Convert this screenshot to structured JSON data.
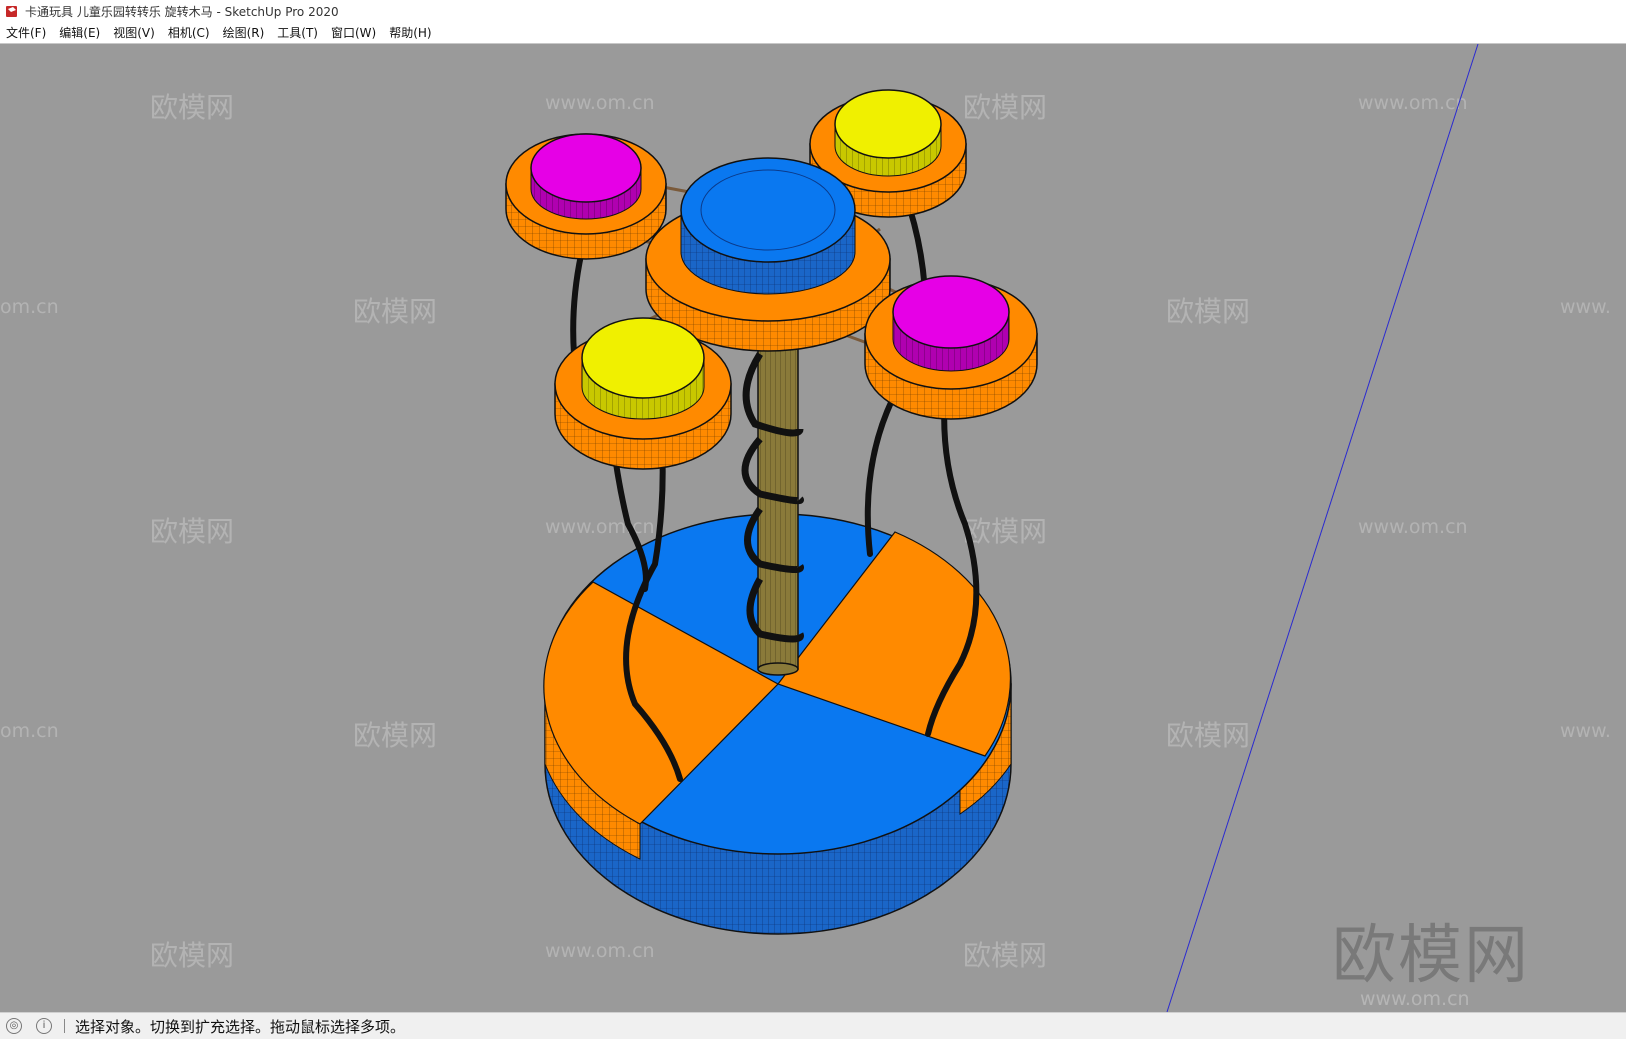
{
  "window": {
    "title": "卡通玩具 儿童乐园转转乐 旋转木马 - SketchUp Pro 2020"
  },
  "menubar": {
    "items": [
      {
        "label": "文件(F)"
      },
      {
        "label": "编辑(E)"
      },
      {
        "label": "视图(V)"
      },
      {
        "label": "相机(C)"
      },
      {
        "label": "绘图(R)"
      },
      {
        "label": "工具(T)"
      },
      {
        "label": "窗口(W)"
      },
      {
        "label": "帮助(H)"
      }
    ]
  },
  "viewport": {
    "background": "#9a9a9a",
    "watermark_brand": "欧模网",
    "watermark_url": "www.om.cn",
    "watermark_url_partial_left": "om.cn",
    "watermark_url_partial_right": "www."
  },
  "model": {
    "colors": {
      "orange": "#ff8a00",
      "blue": "#0a78f0",
      "magenta": "#e600e6",
      "yellow": "#f0f000",
      "pole": "#8a7a3a",
      "dark": "#111111"
    }
  },
  "statusbar": {
    "message": "选择对象。切换到扩充选择。拖动鼠标选择多项。",
    "icons": [
      "geo-location-icon",
      "info-icon"
    ]
  }
}
